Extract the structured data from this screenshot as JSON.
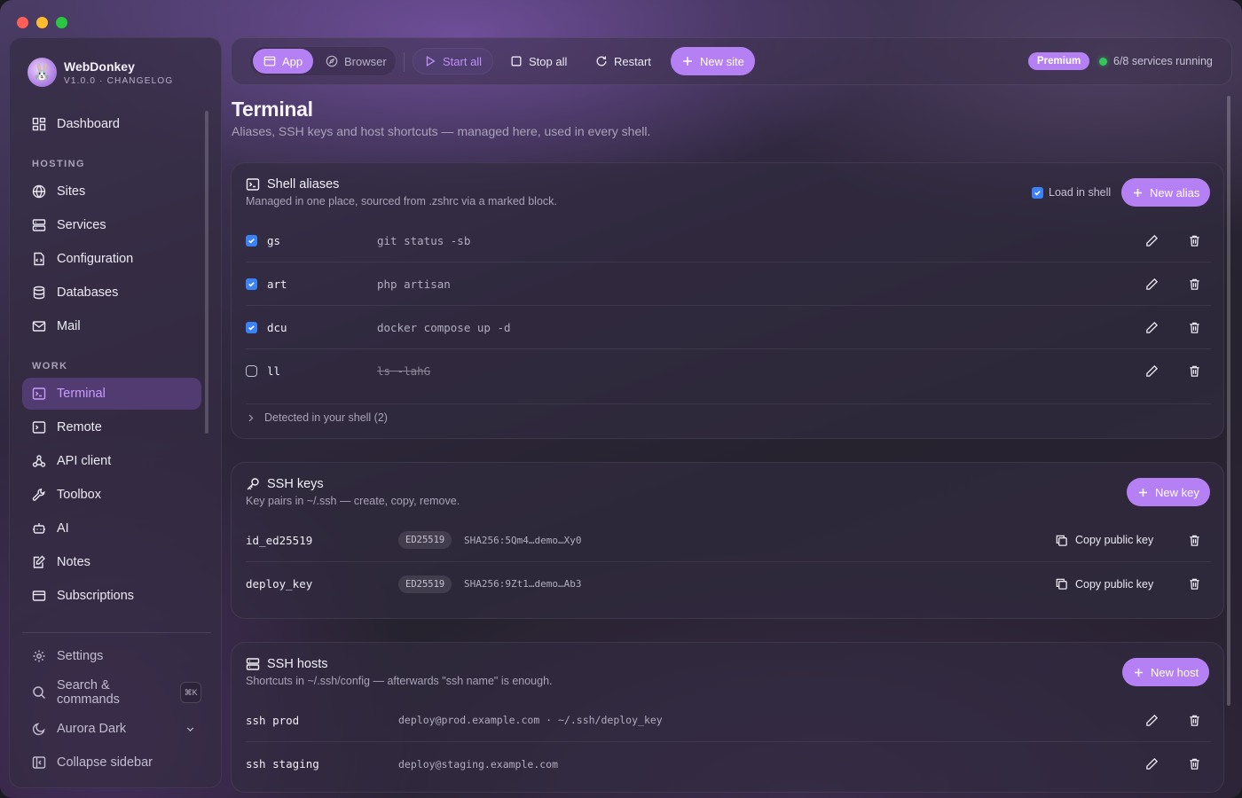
{
  "app": {
    "name": "WebDonkey",
    "version_line": "V1.0.0 · CHANGELOG"
  },
  "sidebar": {
    "top_item": {
      "label": "Dashboard",
      "icon": "dashboard-icon"
    },
    "sections": [
      {
        "label": "HOSTING"
      },
      {
        "label": "WORK"
      }
    ],
    "hosting_items": [
      {
        "label": "Sites",
        "icon": "globe-icon"
      },
      {
        "label": "Services",
        "icon": "server-icon"
      },
      {
        "label": "Configuration",
        "icon": "config-file-icon"
      },
      {
        "label": "Databases",
        "icon": "database-icon"
      },
      {
        "label": "Mail",
        "icon": "mail-icon"
      }
    ],
    "work_items": [
      {
        "label": "Terminal",
        "icon": "terminal-icon",
        "active": true
      },
      {
        "label": "Remote",
        "icon": "remote-terminal-icon"
      },
      {
        "label": "API client",
        "icon": "webhook-icon"
      },
      {
        "label": "Toolbox",
        "icon": "wrench-icon"
      },
      {
        "label": "AI",
        "icon": "bot-icon"
      },
      {
        "label": "Notes",
        "icon": "notes-icon"
      },
      {
        "label": "Subscriptions",
        "icon": "card-icon"
      }
    ],
    "footer": {
      "settings": "Settings",
      "search": "Search & commands",
      "search_shortcut": "⌘K",
      "theme": "Aurora Dark",
      "collapse": "Collapse sidebar"
    }
  },
  "toolbar": {
    "app_label": "App",
    "browser_label": "Browser",
    "start_all": "Start all",
    "stop_all": "Stop all",
    "restart": "Restart",
    "new_site": "New site",
    "premium": "Premium",
    "status": "6/8 services running"
  },
  "page": {
    "title": "Terminal",
    "subtitle": "Aliases, SSH keys and host shortcuts — managed here, used in every shell."
  },
  "aliases": {
    "title": "Shell aliases",
    "subtitle": "Managed in one place, sourced from .zshrc via a marked block.",
    "load_in_shell": "Load in shell",
    "new_alias": "New alias",
    "rows": [
      {
        "name": "gs",
        "command": "git status -sb",
        "enabled": true
      },
      {
        "name": "art",
        "command": "php artisan",
        "enabled": true
      },
      {
        "name": "dcu",
        "command": "docker compose up -d",
        "enabled": true
      },
      {
        "name": "ll",
        "command": "ls -lahG",
        "enabled": false
      }
    ],
    "detected": "Detected in your shell (2)"
  },
  "ssh_keys": {
    "title": "SSH keys",
    "subtitle": "Key pairs in ~/.ssh — create, copy, remove.",
    "new_key": "New key",
    "copy_label": "Copy public key",
    "rows": [
      {
        "name": "id_ed25519",
        "type": "ED25519",
        "fingerprint": "SHA256:5Qm4…demo…Xy0"
      },
      {
        "name": "deploy_key",
        "type": "ED25519",
        "fingerprint": "SHA256:9Zt1…demo…Ab3"
      }
    ]
  },
  "ssh_hosts": {
    "title": "SSH hosts",
    "subtitle": "Shortcuts in ~/.ssh/config — afterwards \"ssh name\" is enough.",
    "new_host": "New host",
    "rows": [
      {
        "name": "ssh prod",
        "target": "deploy@prod.example.com · ~/.ssh/deploy_key"
      },
      {
        "name": "ssh staging",
        "target": "deploy@staging.example.com"
      }
    ]
  },
  "colors": {
    "accent": "#b680f5",
    "checkbox": "#3b82f6",
    "status_ok": "#34c759"
  }
}
